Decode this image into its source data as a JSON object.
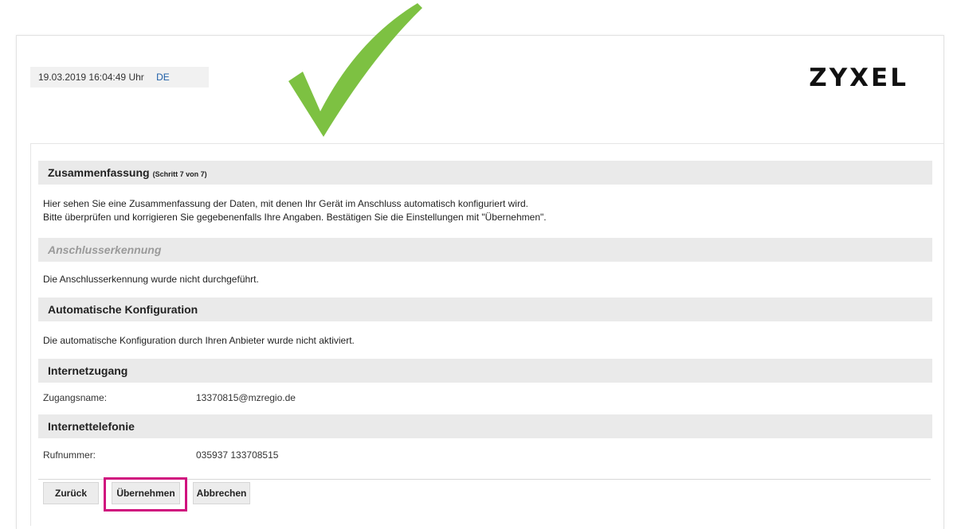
{
  "header": {
    "datetime": "19.03.2019 16:04:49 Uhr",
    "language": "DE",
    "logo_text": "ZYXEL"
  },
  "annotation": {
    "checkmark_icon": "green-checkmark-icon",
    "checkmark_color": "#7dc142",
    "highlight_color": "#d0117e"
  },
  "summary": {
    "title": "Zusammenfassung",
    "step": "(Schritt 7 von 7)",
    "line1": "Hier sehen Sie eine Zusammenfassung der Daten, mit denen Ihr Gerät im Anschluss automatisch konfiguriert wird.",
    "line2": "Bitte überprüfen und korrigieren Sie gegebenenfalls Ihre Angaben. Bestätigen Sie die Einstellungen mit \"Übernehmen\"."
  },
  "anschluss": {
    "title": "Anschlusserkennung",
    "text": "Die Anschlusserkennung wurde nicht durchgeführt."
  },
  "autoconfig": {
    "title": "Automatische Konfiguration",
    "text": "Die automatische Konfiguration durch Ihren Anbieter wurde nicht aktiviert."
  },
  "internet": {
    "title": "Internetzugang",
    "label": "Zugangsname:",
    "value": "13370815@mzregio.de"
  },
  "telefonie": {
    "title": "Internettelefonie",
    "label": "Rufnummer:",
    "value": "035937 133708515"
  },
  "buttons": {
    "back": "Zurück",
    "apply": "Übernehmen",
    "cancel": "Abbrechen"
  }
}
